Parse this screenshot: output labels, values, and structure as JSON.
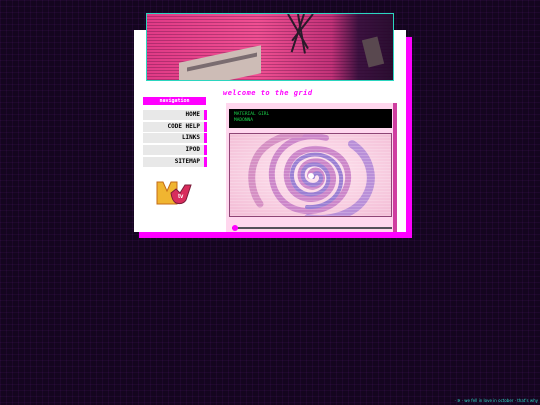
{
  "navigation": {
    "heading": "navigation",
    "items": [
      {
        "label": "HOME"
      },
      {
        "label": "CODE HELP"
      },
      {
        "label": "LINKS"
      },
      {
        "label": "IPOD"
      },
      {
        "label": "SITEMAP"
      }
    ]
  },
  "main": {
    "heading": "welcome to the grid",
    "terminal_lines": [
      "MATERIAL GIRL",
      "MADONNA"
    ]
  },
  "footer": {
    "text": "· ✲ · we fell in love in october · that's why"
  },
  "logo": {
    "name": "mtv-logo"
  },
  "colors": {
    "accent": "#ff00ff",
    "teal": "#2bd6c0",
    "terminal_text": "#19d34a"
  },
  "player": {
    "progress": 0.02
  }
}
